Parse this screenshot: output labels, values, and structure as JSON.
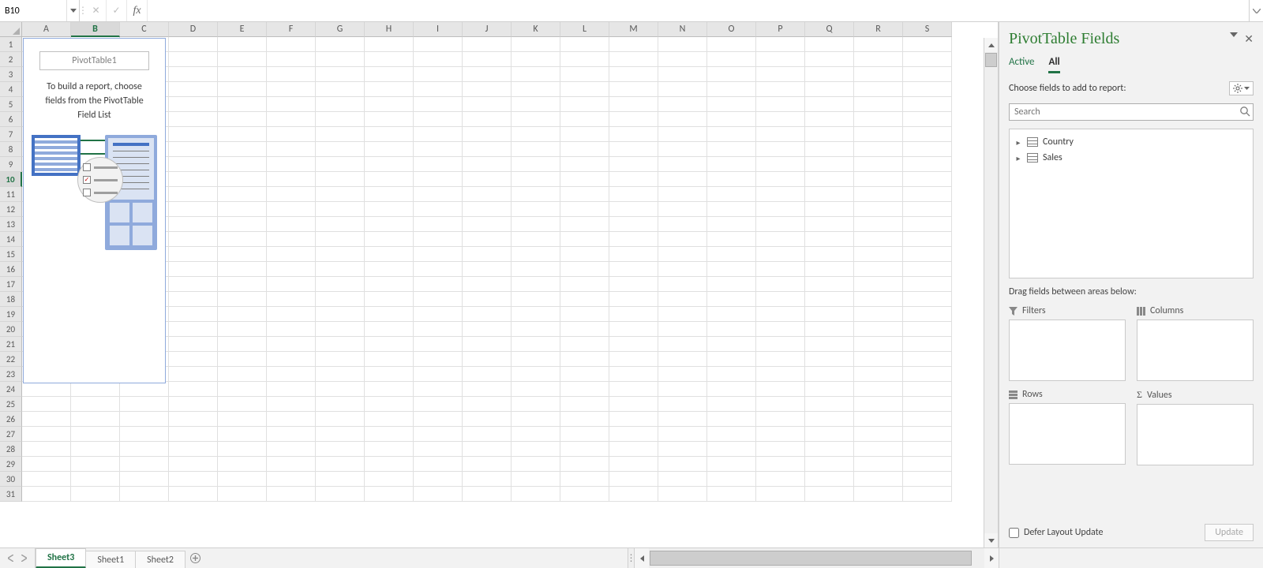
{
  "formula_bar": {
    "name_box_value": "B10",
    "formula_value": "",
    "fx_label": "fx"
  },
  "grid": {
    "columns": [
      "A",
      "B",
      "C",
      "D",
      "E",
      "F",
      "G",
      "H",
      "I",
      "J",
      "K",
      "L",
      "M",
      "N",
      "O",
      "P",
      "Q",
      "R",
      "S"
    ],
    "row_count": 31,
    "selected_cell": "B10",
    "selected_col_index": 1,
    "selected_row_index": 9
  },
  "pivot_placeholder": {
    "name": "PivotTable1",
    "help_line1": "To build a report, choose",
    "help_line2": "fields from the PivotTable",
    "help_line3": "Field List"
  },
  "task_pane": {
    "title": "PivotTable Fields",
    "tab_active": "Active",
    "tab_all": "All",
    "choose_label": "Choose fields to add to report:",
    "search_placeholder": "Search",
    "fields": [
      {
        "label": "Country"
      },
      {
        "label": "Sales"
      }
    ],
    "drag_label": "Drag fields between areas below:",
    "areas": {
      "filters": "Filters",
      "columns": "Columns",
      "rows": "Rows",
      "values": "Values"
    },
    "defer_label": "Defer Layout Update",
    "update_label": "Update"
  },
  "sheet_tabs": {
    "tabs": [
      "Sheet3",
      "Sheet1",
      "Sheet2"
    ],
    "active_index": 0
  }
}
